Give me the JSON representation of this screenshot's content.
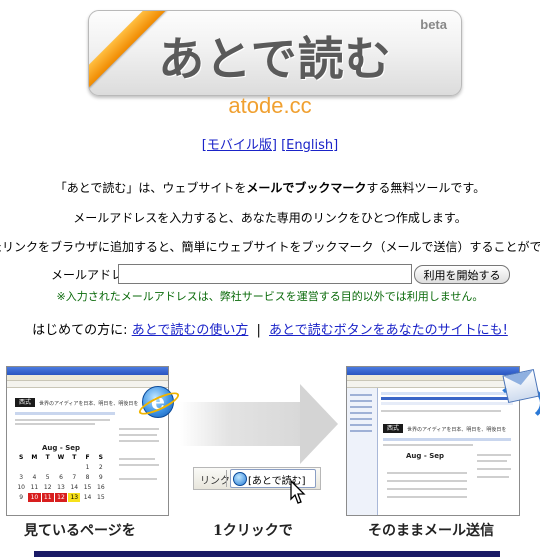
{
  "logo": {
    "text": "あとで読む",
    "badge": "beta",
    "domain": "atode.cc"
  },
  "nav": {
    "mobile_link": "[モバイル版]",
    "english_link": "[English]"
  },
  "description": {
    "line1_prefix": "「あとで読む」は、ウェブサイトを",
    "line1_bold": "メールでブックマーク",
    "line1_suffix": "する無料ツールです。",
    "line2": "メールアドレスを入力すると、あなた専用のリンクをひとつ作成します。",
    "line3": "たリンクをブラウザに追加すると、簡単にウェブサイトをブックマーク（メールで送信）することができて"
  },
  "form": {
    "email_label": "メールアドレス：",
    "email_value": "",
    "start_button": "利用を開始する",
    "note": "※入力されたメールアドレスは、弊社サービスを運営する目的以外では利用しません。"
  },
  "intro": {
    "prefix": "はじめての方に:",
    "how_to_link": "あとで読むの使い方",
    "separator": "|",
    "button_link": "あとで読むボタンをあなたのサイトにも!"
  },
  "illustration": {
    "calendar_title": "Aug - Sep",
    "calendar_headers": [
      "S",
      "M",
      "T",
      "W",
      "T",
      "F",
      "S"
    ],
    "calendar_rows": [
      [
        "",
        "",
        "",
        "",
        "",
        "1",
        "2"
      ],
      [
        "3",
        "4",
        "5",
        "6",
        "7",
        "8",
        "9"
      ],
      [
        "10",
        "11",
        "12",
        "13",
        "14",
        "15",
        "16"
      ],
      [
        "9",
        "10",
        "11",
        "12",
        "13",
        "14",
        "15"
      ]
    ],
    "site_logo": "西式",
    "site_tagline": "世界のアイディアを日本、明日を、明後日を",
    "right_site_tagline": "世界のアイディアを日本、明日を、明後日を",
    "link_bar_label": "リンク",
    "link_bar_button": "[あとで読む]",
    "ie_glyph": "e"
  },
  "captions": {
    "step1": "見ているページを",
    "step2": "1クリックで",
    "step3": "そのままメール送信"
  },
  "colors": {
    "link": "#1a23c8",
    "note": "#0a6a0a",
    "domain": "#f0a030",
    "ribbon": "#f08a00"
  }
}
